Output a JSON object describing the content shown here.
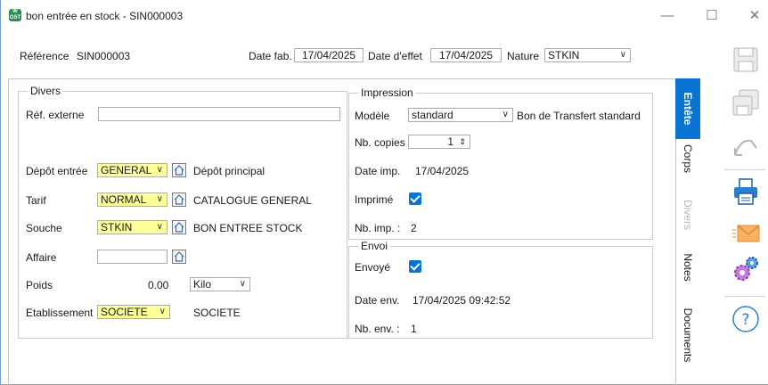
{
  "window": {
    "title": "bon entrée en stock - SIN000003",
    "app_icon_text": "W GST"
  },
  "header": {
    "reference_label": "Référence",
    "reference_value": "SIN000003",
    "date_fab_label": "Date fab.",
    "date_fab_value": "17/04/2025",
    "date_effet_label": "Date d'effet",
    "date_effet_value": "17/04/2025",
    "nature_label": "Nature",
    "nature_value": "STKIN"
  },
  "divers": {
    "title": "Divers",
    "ref_externe_label": "Réf. externe",
    "ref_externe_value": "",
    "depot_label": "Dépôt entrée",
    "depot_value": "GENERAL",
    "depot_desc": "Dépôt principal",
    "tarif_label": "Tarif",
    "tarif_value": "NORMAL",
    "tarif_desc": "CATALOGUE GENERAL",
    "souche_label": "Souche",
    "souche_value": "STKIN",
    "souche_desc": "BON ENTREE STOCK",
    "affaire_label": "Affaire",
    "affaire_value": "",
    "poids_label": "Poids",
    "poids_value": "0.00",
    "poids_unit": "Kilo",
    "etab_label": "Etablissement",
    "etab_value": "SOCIETE",
    "etab_desc": "SOCIETE"
  },
  "impression": {
    "title": "Impression",
    "modele_label": "Modèle",
    "modele_value": "standard",
    "modele_desc": "Bon de Transfert standard",
    "copies_label": "Nb. copies",
    "copies_value": "1",
    "date_imp_label": "Date imp.",
    "date_imp_value": "17/04/2025",
    "imprime_label": "Imprimé",
    "imprime_checked": true,
    "nb_imp_label": "Nb. imp. :",
    "nb_imp_value": "2"
  },
  "envoi": {
    "title": "Envoi",
    "envoye_label": "Envoyé",
    "envoye_checked": true,
    "date_env_label": "Date env.",
    "date_env_value": "17/04/2025 09:42:52",
    "nb_env_label": "Nb. env. :",
    "nb_env_value": "1"
  },
  "tabs": [
    {
      "label": "Entête",
      "active": true
    },
    {
      "label": "Corps"
    },
    {
      "label": "Divers",
      "disabled": true
    },
    {
      "label": "Notes"
    },
    {
      "label": "Documents"
    }
  ],
  "toolbar_icons": [
    "save-icon",
    "save-as-icon",
    "undo-icon",
    "print-icon",
    "email-icon",
    "settings-icon",
    "help-icon"
  ],
  "colors": {
    "accent": "#0a74d4",
    "highlight": "#ffff99"
  }
}
